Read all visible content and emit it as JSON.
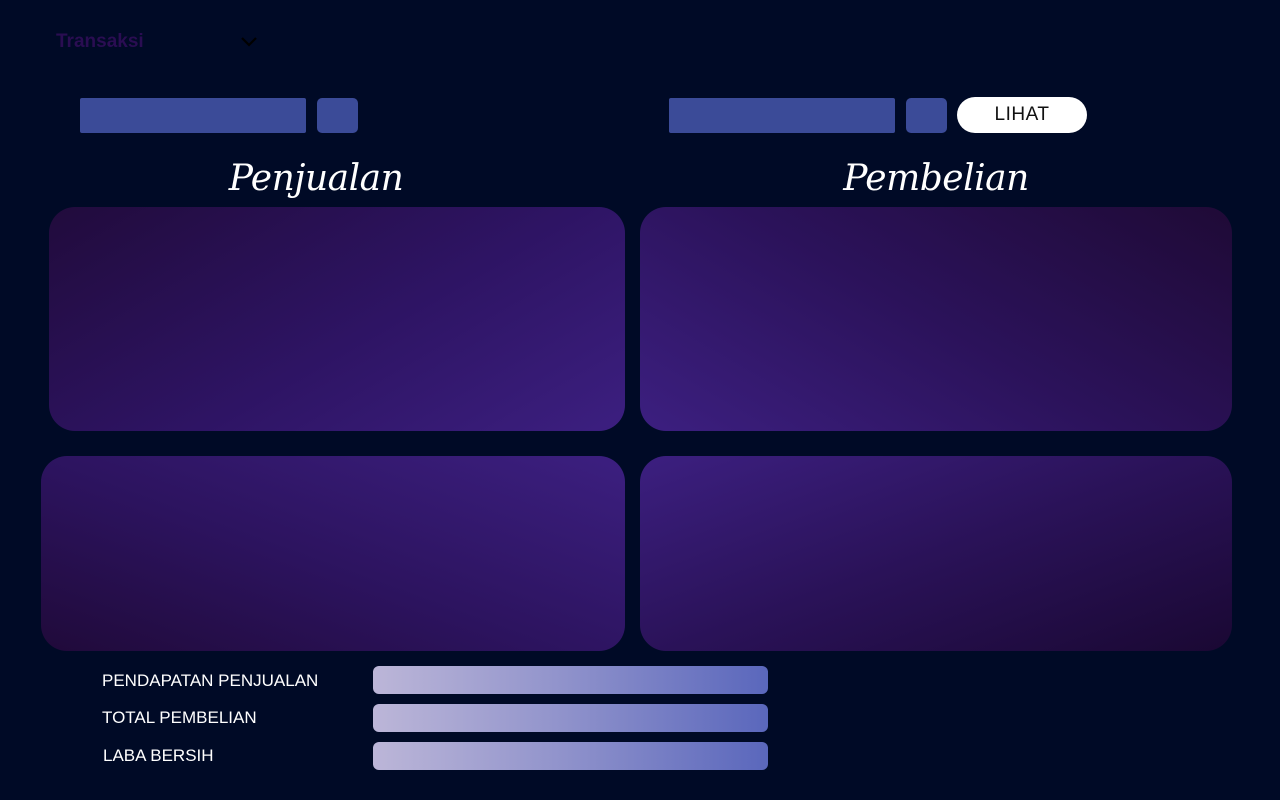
{
  "header": {
    "menu_label": "Transaksi",
    "menu_icon": "chevron-down-icon"
  },
  "filters": {
    "view_button_label": "LIHAT"
  },
  "sections": {
    "sales_title": "Penjualan",
    "purchase_title": "Pembelian"
  },
  "summary": {
    "rows": [
      {
        "label": "PENDAPATAN PENJUALAN"
      },
      {
        "label": "TOTAL PEMBELIAN"
      },
      {
        "label": "LABA BERSIH"
      }
    ]
  },
  "colors": {
    "background": "#000a26",
    "input": "#3b4b98",
    "panel_accent": "#3c1f80",
    "button": "#ffffff"
  }
}
